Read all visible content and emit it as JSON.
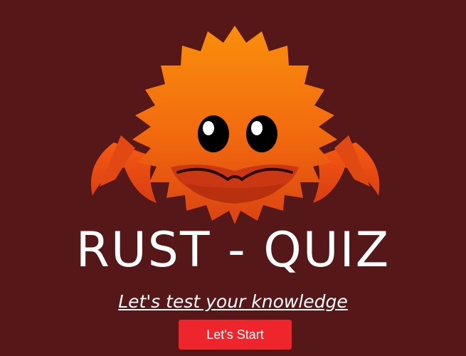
{
  "logo": {
    "icon": "ferris-crab-icon"
  },
  "title": "RUST - QUIZ",
  "subtitle": "Let's test your knowledge",
  "start_button": {
    "label": "Let's Start"
  },
  "colors": {
    "background": "#561719",
    "crab_light": "#f78a0d",
    "crab_dark": "#d73f0f",
    "button": "#ee262b",
    "text": "#ffffff"
  }
}
